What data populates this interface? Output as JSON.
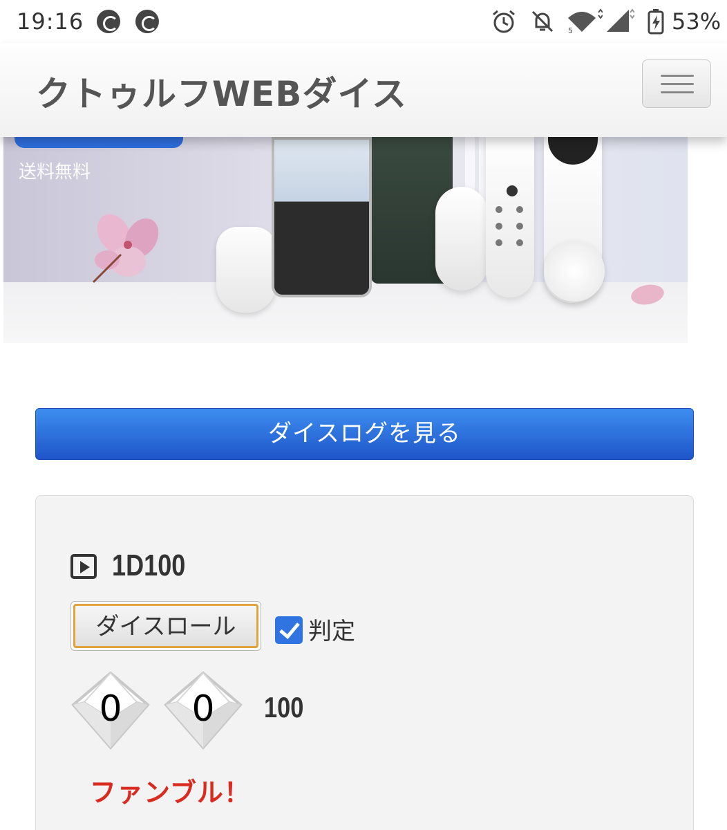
{
  "status_bar": {
    "time": "19:16",
    "battery_percent": "53%",
    "icons": [
      "notification-app-icon",
      "notification-app-icon",
      "alarm-icon",
      "bell-off-icon",
      "wifi-icon",
      "cellular-signal-icon",
      "battery-charging-icon"
    ]
  },
  "header": {
    "title": "クトゥルフWEBダイス",
    "menu_icon": "hamburger-icon"
  },
  "ad": {
    "text": "送料無料"
  },
  "log_button": {
    "label": "ダイスログを見る"
  },
  "dice_panel": {
    "spec_icon": "play-icon",
    "spec": "1D100",
    "roll_button": "ダイスロール",
    "judge": {
      "label": "判定",
      "checked": true
    },
    "dice": [
      "0",
      "0"
    ],
    "total": "100",
    "result": "ファンブル！"
  },
  "colors": {
    "primary_button": "#2f6fe0",
    "result_text": "#d92b1f",
    "focus_border": "#e0a43c"
  }
}
